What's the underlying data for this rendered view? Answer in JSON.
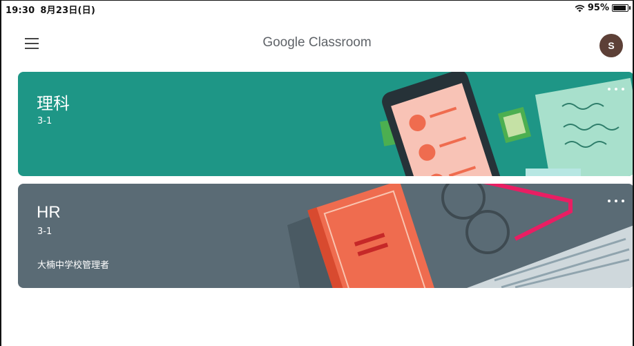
{
  "statusbar": {
    "time": "19:30",
    "date": "8月23日(日)",
    "battery_text": "95%",
    "battery_level": 0.95,
    "wifi_icon": "wifi-icon"
  },
  "appbar": {
    "title": "Google Classroom",
    "menu_icon": "hamburger-menu-icon",
    "avatar_initial": "S",
    "avatar_color": "#5d4037"
  },
  "classes": [
    {
      "name": "理科",
      "section": "3-1",
      "owner": "",
      "color": "#1e9686",
      "theme": "phone-and-letters"
    },
    {
      "name": "HR",
      "section": "3-1",
      "owner": "大楠中学校管理者",
      "color": "#5a6b75",
      "theme": "notebook-and-glasses"
    }
  ],
  "icons": {
    "more": "more-horizontal-icon"
  }
}
